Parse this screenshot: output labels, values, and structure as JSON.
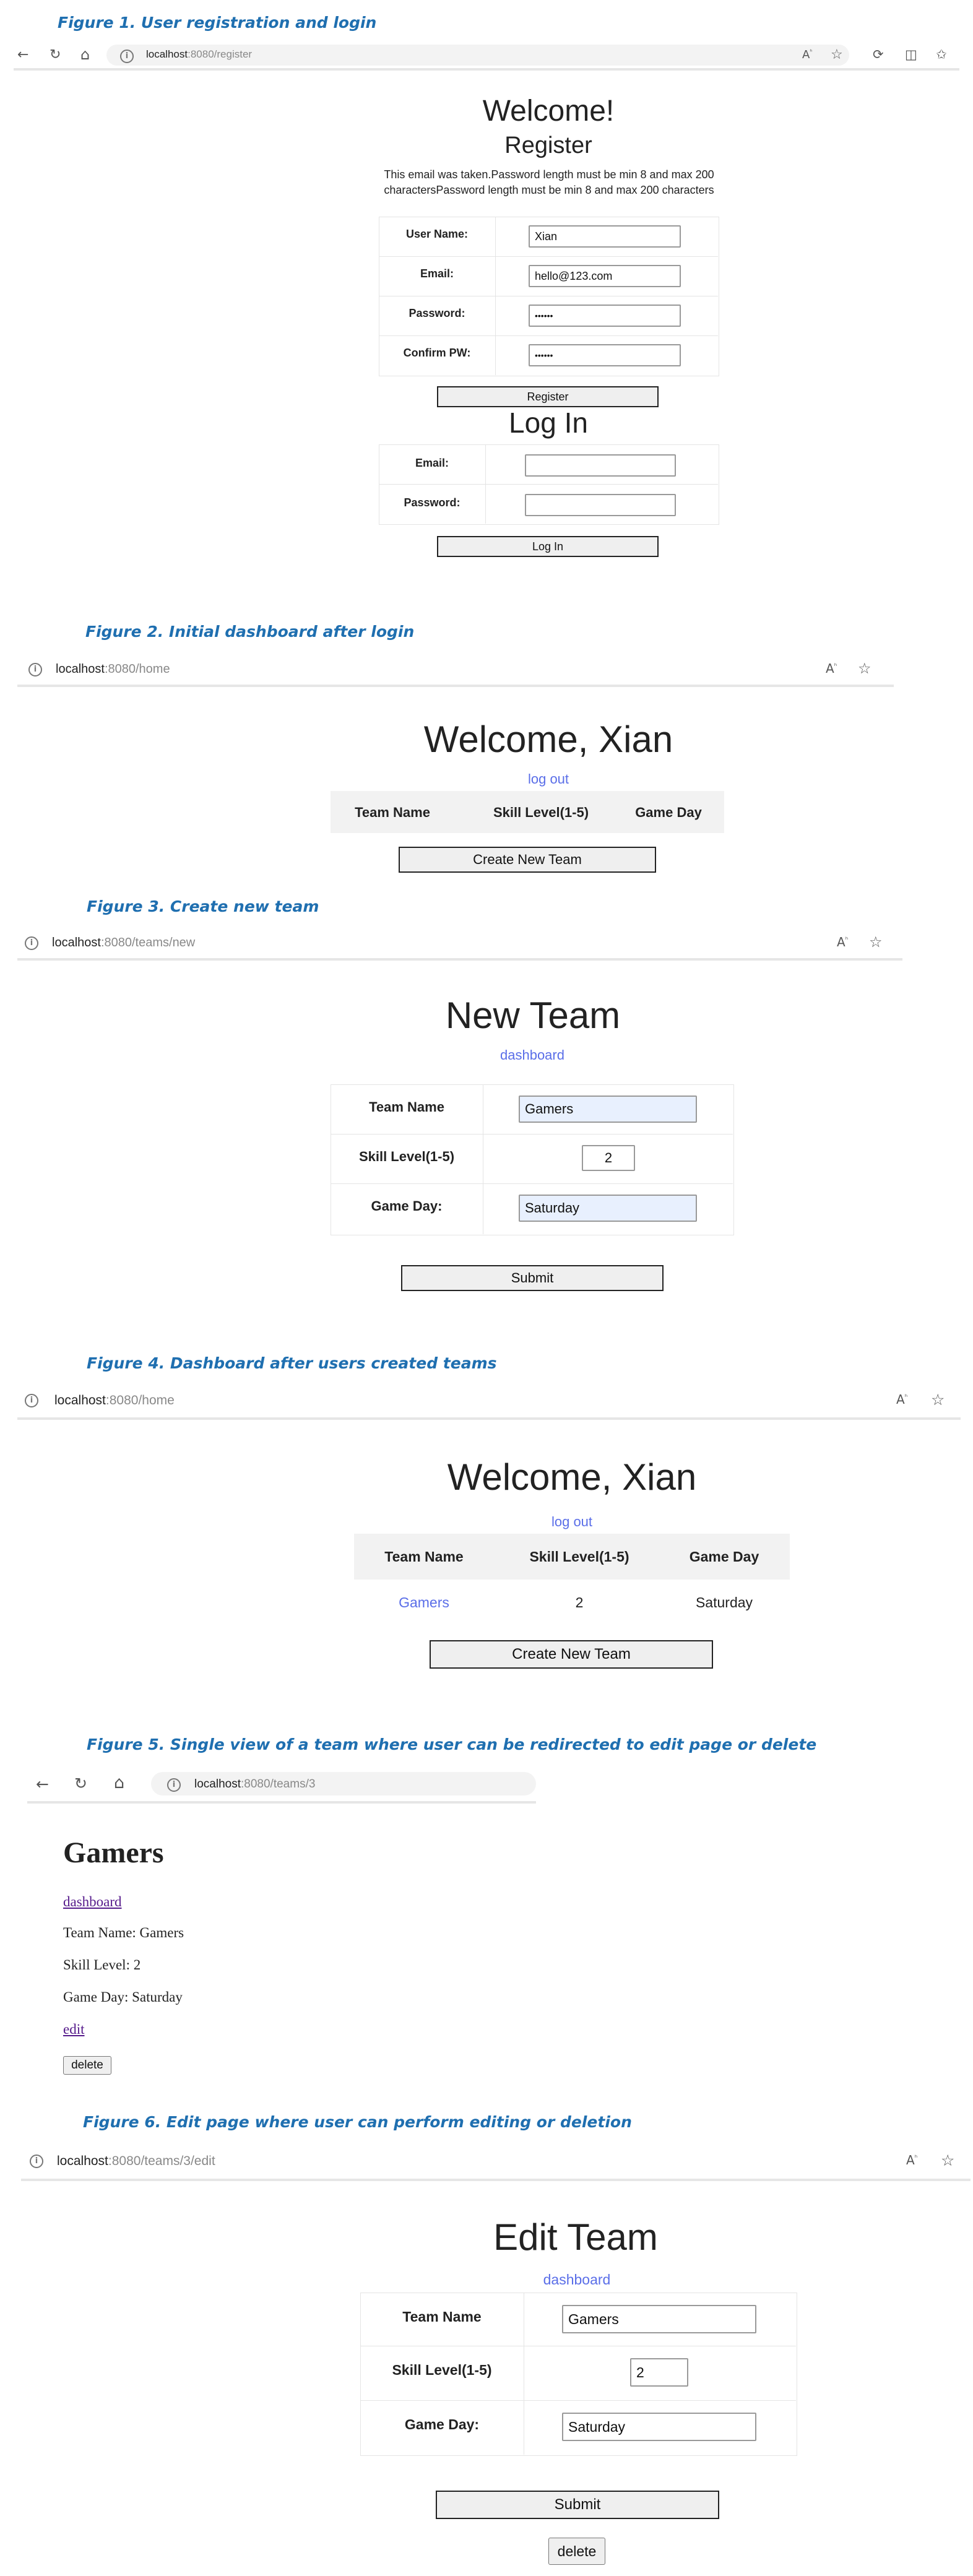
{
  "fig1": {
    "caption": "Figure 1. User registration and login",
    "url_host": "localhost",
    "url_path": ":8080/register",
    "welcome": "Welcome!",
    "register_title": "Register",
    "errors": "This email was taken.Password length must be min 8 and max 200 charactersPassword length must be min 8 and max 200 characters",
    "labels": {
      "username": "User Name:",
      "email": "Email:",
      "password": "Password:",
      "confirm": "Confirm PW:"
    },
    "values": {
      "username": "Xian",
      "email": "hello@123.com",
      "password": "••••••",
      "confirm": "••••••"
    },
    "register_button": "Register",
    "login_title": "Log In",
    "login_labels": {
      "email": "Email:",
      "password": "Password:"
    },
    "login_values": {
      "email": "",
      "password": ""
    },
    "login_button": "Log In"
  },
  "fig2": {
    "caption": "Figure 2. Initial dashboard after login",
    "url_host": "localhost",
    "url_path": ":8080/home",
    "welcome": "Welcome, Xian",
    "logout": "log out",
    "columns": [
      "Team Name",
      "Skill Level(1-5)",
      "Game Day"
    ],
    "create_button": "Create New Team"
  },
  "fig3": {
    "caption": "Figure 3. Create new team",
    "url_host": "localhost",
    "url_path": ":8080/teams/new",
    "title": "New Team",
    "dashboard_link": "dashboard",
    "labels": {
      "team_name": "Team Name",
      "skill": "Skill Level(1-5)",
      "day": "Game Day:"
    },
    "values": {
      "team_name": "Gamers",
      "skill": "2",
      "day": "Saturday"
    },
    "submit_button": "Submit"
  },
  "fig4": {
    "caption": "Figure 4. Dashboard after users created teams",
    "url_host": "localhost",
    "url_path": ":8080/home",
    "welcome": "Welcome, Xian",
    "logout": "log out",
    "columns": [
      "Team Name",
      "Skill Level(1-5)",
      "Game Day"
    ],
    "rows": [
      {
        "team": "Gamers",
        "skill": "2",
        "day": "Saturday"
      }
    ],
    "create_button": "Create New Team"
  },
  "fig5": {
    "caption": "Figure 5. Single view of a team where user can be redirected to edit page or delete",
    "url_host": "localhost",
    "url_path": ":8080/teams/3",
    "title": "Gamers",
    "dashboard_link": "dashboard",
    "team_name": "Team Name: Gamers",
    "skill": "Skill Level: 2",
    "day": "Game Day: Saturday",
    "edit_link": "edit",
    "delete_button": "delete"
  },
  "fig6": {
    "caption": "Figure 6. Edit page where user can perform editing or deletion",
    "url_host": "localhost",
    "url_path": ":8080/teams/3/edit",
    "title": "Edit Team",
    "dashboard_link": "dashboard",
    "labels": {
      "team_name": "Team Name",
      "skill": "Skill Level(1-5)",
      "day": "Game Day:"
    },
    "values": {
      "team_name": "Gamers",
      "skill": "2",
      "day": "Saturday"
    },
    "submit_button": "Submit",
    "delete_button": "delete"
  },
  "colors": {
    "caption": "#1f6fb0",
    "link": "#5a6ee8",
    "header_bg": "#f2f2f2",
    "input_highlight": "#e8f0fe"
  },
  "icons": [
    "back-arrow-icon",
    "refresh-icon",
    "home-icon",
    "info-icon",
    "read-aloud-icon",
    "star-icon",
    "extensions-icon",
    "split-screen-icon",
    "favorites-icon"
  ]
}
